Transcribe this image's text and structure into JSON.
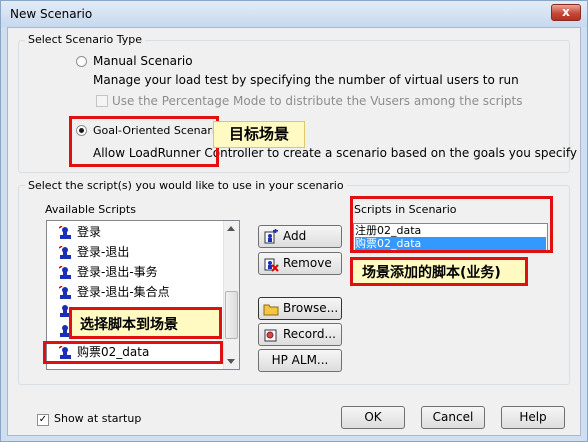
{
  "window": {
    "title": "New Scenario",
    "close_glyph": "x"
  },
  "scenario_type_group": {
    "label": "Select Scenario Type",
    "manual": {
      "label": "Manual Scenario",
      "description": "Manage your load test by specifying the number of virtual users to run",
      "percentage_mode_label": "Use the Percentage Mode to distribute the Vusers among the scripts",
      "selected": false
    },
    "goal": {
      "label": "Goal-Oriented Scenario",
      "description": "Allow LoadRunner Controller to create a scenario based on the goals you specify",
      "selected": true
    }
  },
  "scripts_group": {
    "label": "Select the script(s) you would like to use in your scenario",
    "available_label": "Available Scripts",
    "available_scripts": [
      "登录",
      "登录-退出",
      "登录-退出-事务",
      "登录-退出-集合点",
      "",
      "",
      "购票02_data"
    ],
    "scenario_label": "Scripts in Scenario",
    "scenario_scripts": [
      "注册02_data",
      "购票02_data"
    ],
    "selected_scenario_index": 1
  },
  "buttons": {
    "add": "Add ==>>",
    "remove": "Remove",
    "browse": "Browse...",
    "record": "Record...",
    "hp_alm": "HP ALM...",
    "ok": "OK",
    "cancel": "Cancel",
    "help": "Help"
  },
  "show_at_startup": {
    "label": "Show at startup",
    "checked": true
  },
  "annotations": {
    "goal_callout": "目标场景",
    "scenario_callout": "场景添加的脚本(业务)",
    "select_callout": "选择脚本到场景"
  },
  "colors": {
    "annotation_red": "#e01010",
    "callout_fill": "#fff9c2",
    "selection_blue": "#3399ff"
  }
}
